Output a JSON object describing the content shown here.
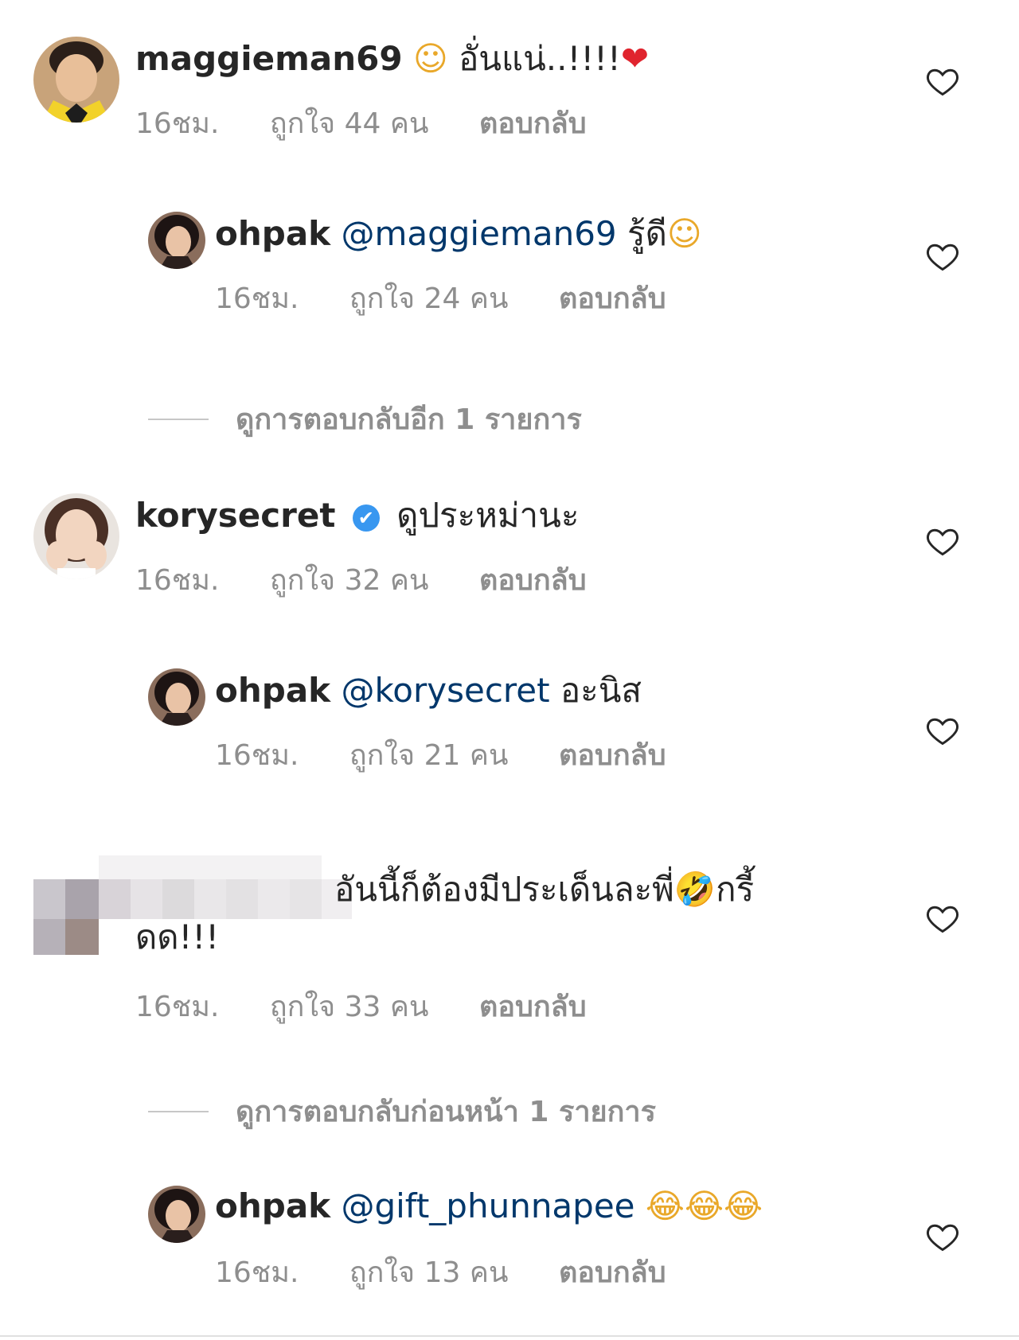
{
  "comments": [
    {
      "user": "maggieman69",
      "mention": "",
      "text_before_emoji": "",
      "emoji1": "☺",
      "text": " อั่นแน่..!!!!",
      "emoji2": "❤",
      "time": "16ชม.",
      "likes": "ถูกใจ 44 คน",
      "reply": "ตอบกลับ"
    },
    {
      "user": "ohpak",
      "mention": "@maggieman69",
      "text": " รู้ดี",
      "emoji1": "☺",
      "time": "16ชม.",
      "likes": "ถูกใจ 24 คน",
      "reply": "ตอบกลับ"
    },
    {
      "user": "korysecret",
      "verified": "✔",
      "text": "ดูประหม่านะ",
      "time": "16ชม.",
      "likes": "ถูกใจ 32 คน",
      "reply": "ตอบกลับ"
    },
    {
      "user": "ohpak",
      "mention": "@korysecret",
      "text": " อะนิส",
      "time": "16ชม.",
      "likes": "ถูกใจ 21 คน",
      "reply": "ตอบกลับ"
    },
    {
      "user": "",
      "text_line1": "อันนี้ก็ต้องมีประเด็นละพี่",
      "emoji1": "🤣",
      "text_line1_end": "กรี้",
      "text_line2": "ดด!!!",
      "time": "16ชม.",
      "likes": "ถูกใจ 33 คน",
      "reply": "ตอบกลับ"
    },
    {
      "user": "ohpak",
      "mention": "@gift_phunnapee",
      "emoji1": "😂",
      "emoji2": "😂",
      "emoji3": "😂",
      "time": "16ชม.",
      "likes": "ถูกใจ 13 คน",
      "reply": "ตอบกลับ"
    }
  ],
  "view_more_1": "ดูการตอบกลับอีก 1 รายการ",
  "view_more_2": "ดูการตอบกลับก่อนหน้า 1 รายการ",
  "colors": {
    "username": "#262626",
    "mention": "#00376b",
    "meta": "#8e8e8e",
    "verified": "#3897f0",
    "heart_outline": "#262626"
  }
}
